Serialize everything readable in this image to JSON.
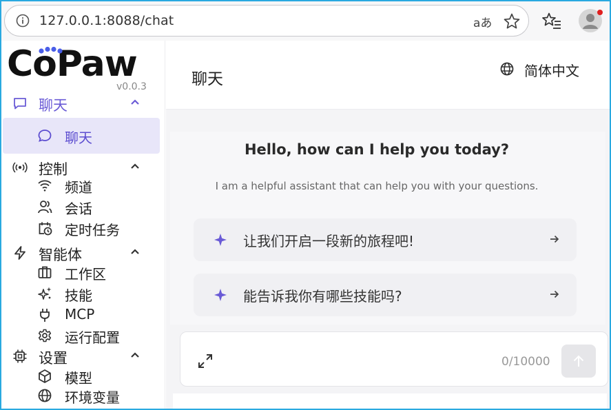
{
  "browser": {
    "url": "127.0.0.1:8088/chat",
    "translate_glyph": "aあ"
  },
  "sidebar": {
    "logo": "CoPaw",
    "version": "v0.0.3",
    "groups": [
      {
        "label": "聊天",
        "icon": "message-square-icon",
        "items": [
          {
            "label": "聊天",
            "icon": "chat-bubble-icon"
          }
        ]
      },
      {
        "label": "控制",
        "icon": "broadcast-icon",
        "items": [
          {
            "label": "频道",
            "icon": "wifi-icon"
          },
          {
            "label": "会话",
            "icon": "users-icon"
          },
          {
            "label": "定时任务",
            "icon": "calendar-clock-icon"
          }
        ]
      },
      {
        "label": "智能体",
        "icon": "lightning-icon",
        "items": [
          {
            "label": "工作区",
            "icon": "briefcase-icon"
          },
          {
            "label": "技能",
            "icon": "sparkles-icon"
          },
          {
            "label": "MCP",
            "icon": "plug-icon"
          },
          {
            "label": "运行配置",
            "icon": "gear-icon"
          }
        ]
      },
      {
        "label": "设置",
        "icon": "cpu-icon",
        "items": [
          {
            "label": "模型",
            "icon": "cube-icon"
          },
          {
            "label": "环境变量",
            "icon": "globe-icon"
          }
        ]
      }
    ]
  },
  "header": {
    "title": "聊天",
    "language": "简体中文"
  },
  "chat": {
    "welcome_title": "Hello, how can I help you today?",
    "welcome_subtitle": "I am a helpful assistant that can help you with your questions.",
    "prompts": [
      "让我们开启一段新的旅程吧!",
      "能告诉我你有哪些技能吗?"
    ]
  },
  "composer": {
    "counter": "0/10000"
  },
  "colors": {
    "accent": "#6a5bd6",
    "selected_bg": "#e8e6f9",
    "frame_border": "#29a9e0"
  }
}
